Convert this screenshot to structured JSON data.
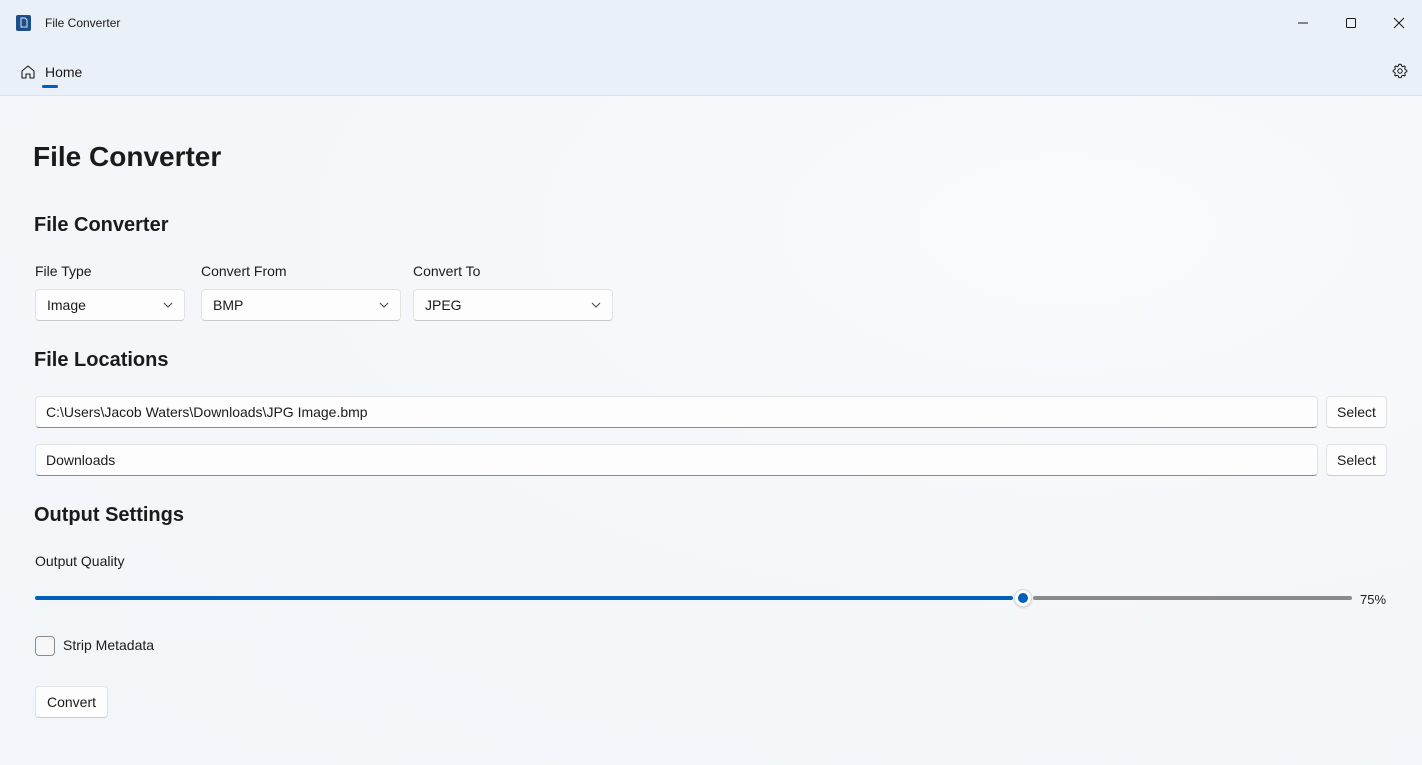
{
  "window": {
    "title": "File Converter"
  },
  "nav": {
    "home_label": "Home"
  },
  "page": {
    "title": "File Converter"
  },
  "converter": {
    "section_title": "File Converter",
    "file_type": {
      "label": "File Type",
      "value": "Image"
    },
    "convert_from": {
      "label": "Convert From",
      "value": "BMP"
    },
    "convert_to": {
      "label": "Convert To",
      "value": "JPEG"
    }
  },
  "locations": {
    "section_title": "File Locations",
    "input_path": "C:\\Users\\Jacob Waters\\Downloads\\JPG Image.bmp",
    "output_path": "Downloads",
    "select_label": "Select"
  },
  "output": {
    "section_title": "Output Settings",
    "quality_label": "Output Quality",
    "quality_value": 75,
    "quality_text": "75%",
    "strip_metadata_label": "Strip Metadata",
    "strip_metadata_checked": false
  },
  "actions": {
    "convert_label": "Convert"
  },
  "colors": {
    "accent": "#005fb8",
    "track": "#8a8a8a"
  }
}
